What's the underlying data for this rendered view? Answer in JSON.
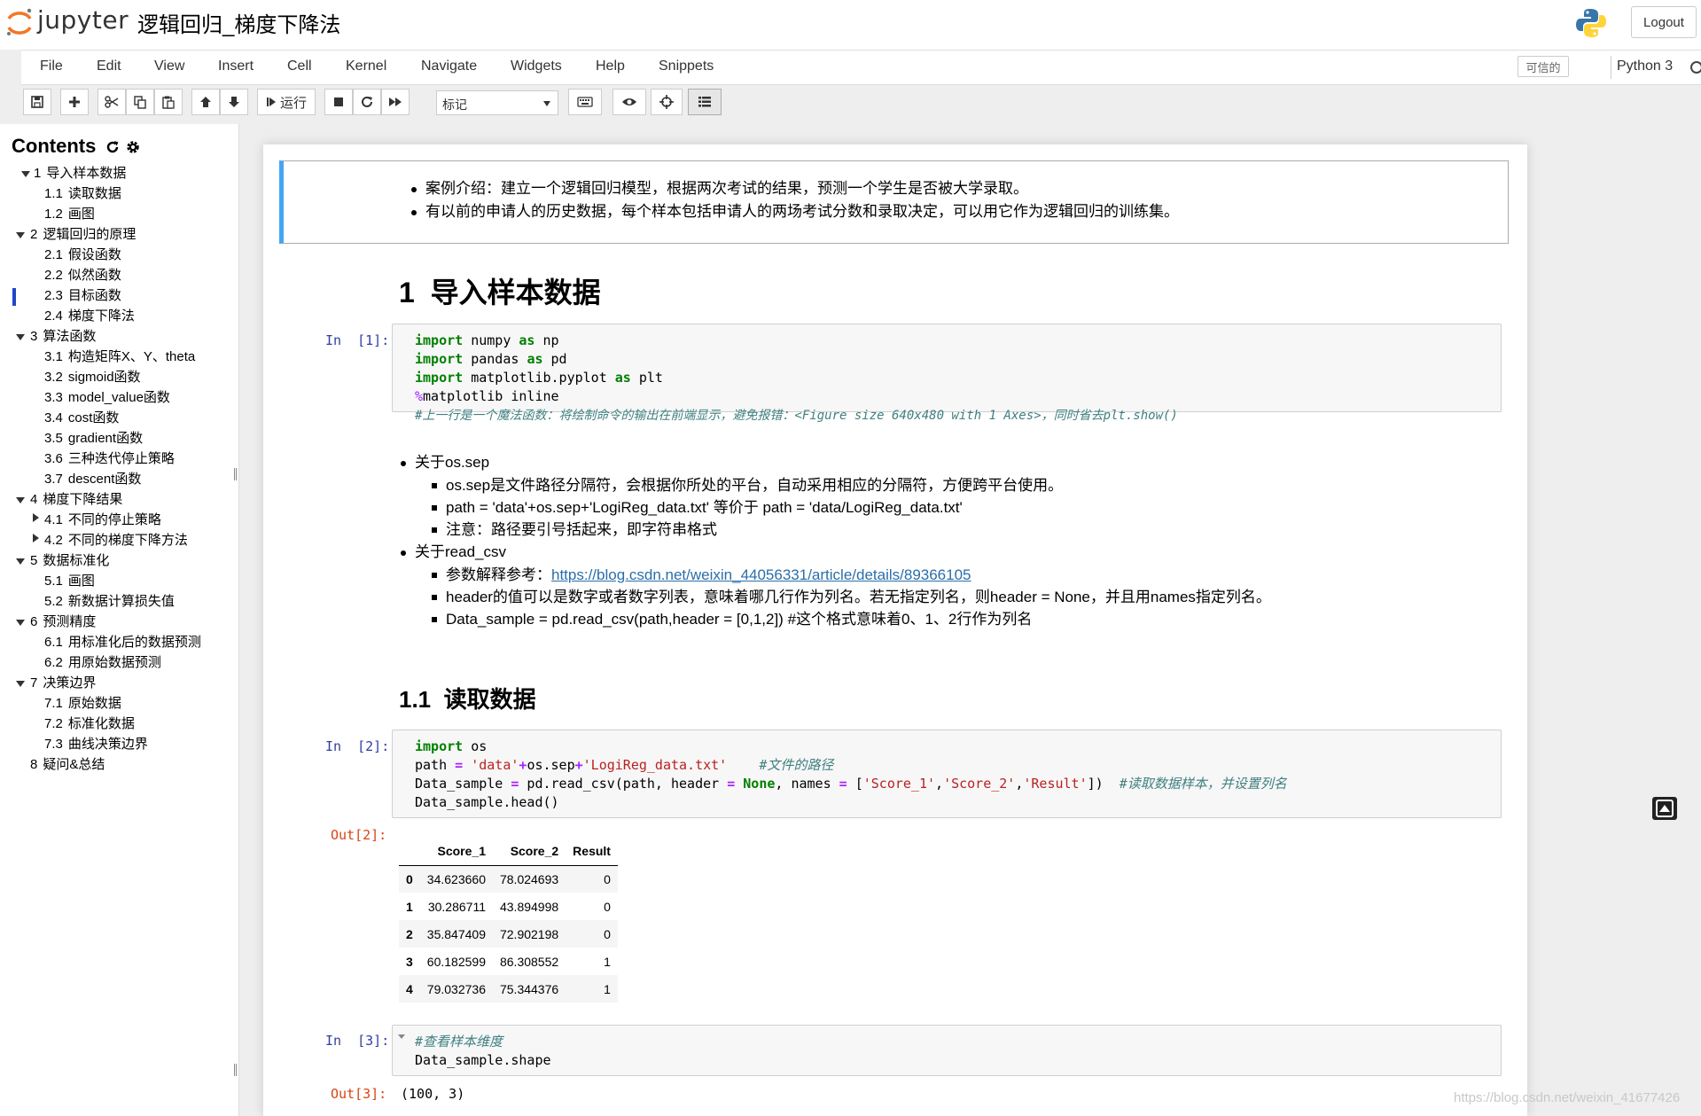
{
  "header": {
    "logo_text": "jupyter",
    "notebook_title": "逻辑回归_梯度下降法",
    "logout_label": "Logout"
  },
  "menubar": {
    "items": [
      "File",
      "Edit",
      "View",
      "Insert",
      "Cell",
      "Kernel",
      "Navigate",
      "Widgets",
      "Help",
      "Snippets"
    ],
    "trusted_label": "可信的",
    "kernel_name": "Python 3"
  },
  "toolbar": {
    "run_label": "运行",
    "cell_type": "标记",
    "icons": [
      "save-icon",
      "plus-icon",
      "cut-icon",
      "copy-icon",
      "paste-icon",
      "arrow-up-icon",
      "arrow-down-icon",
      "step-forward-icon",
      "stop-icon",
      "refresh-icon",
      "fast-forward-icon",
      "keyboard-icon",
      "eye-icon",
      "crosshairs-icon",
      "list-icon"
    ]
  },
  "toc": {
    "title": "Contents",
    "items": [
      {
        "num": "1",
        "label": "导入样本数据"
      },
      {
        "num": "1.1",
        "label": "读取数据"
      },
      {
        "num": "1.2",
        "label": "画图"
      },
      {
        "num": "2",
        "label": "逻辑回归的原理"
      },
      {
        "num": "2.1",
        "label": "假设函数"
      },
      {
        "num": "2.2",
        "label": "似然函数"
      },
      {
        "num": "2.3",
        "label": "目标函数"
      },
      {
        "num": "2.4",
        "label": "梯度下降法"
      },
      {
        "num": "3",
        "label": "算法函数"
      },
      {
        "num": "3.1",
        "label": "构造矩阵X、Y、theta"
      },
      {
        "num": "3.2",
        "label": "sigmoid函数"
      },
      {
        "num": "3.3",
        "label": "model_value函数"
      },
      {
        "num": "3.4",
        "label": "cost函数"
      },
      {
        "num": "3.5",
        "label": "gradient函数"
      },
      {
        "num": "3.6",
        "label": "三种迭代停止策略"
      },
      {
        "num": "3.7",
        "label": "descent函数"
      },
      {
        "num": "4",
        "label": "梯度下降结果"
      },
      {
        "num": "4.1",
        "label": "不同的停止策略"
      },
      {
        "num": "4.2",
        "label": "不同的梯度下降方法"
      },
      {
        "num": "5",
        "label": "数据标准化"
      },
      {
        "num": "5.1",
        "label": "画图"
      },
      {
        "num": "5.2",
        "label": "新数据计算损失值"
      },
      {
        "num": "6",
        "label": "预测精度"
      },
      {
        "num": "6.1",
        "label": "用标准化后的数据预测"
      },
      {
        "num": "6.2",
        "label": "用原始数据预测"
      },
      {
        "num": "7",
        "label": "决策边界"
      },
      {
        "num": "7.1",
        "label": "原始数据"
      },
      {
        "num": "7.2",
        "label": "标准化数据"
      },
      {
        "num": "7.3",
        "label": "曲线决策边界"
      },
      {
        "num": "8",
        "label": "疑问&总结"
      }
    ]
  },
  "cells": {
    "intro": [
      "案例介绍：建立一个逻辑回归模型，根据两次考试的结果，预测一个学生是否被大学录取。",
      "有以前的申请人的历史数据，每个样本包括申请人的两场考试分数和录取决定，可以用它作为逻辑回归的训练集。"
    ],
    "h1_num": "1",
    "h1_text": "导入样本数据",
    "cell1_prompt": "In  [1]:",
    "cell1_lines": {
      "l1_kw": "import",
      "l1_mod": " numpy ",
      "l1_as": "as",
      "l1_alias": " np",
      "l2_kw": "import",
      "l2_mod": " pandas ",
      "l2_as": "as",
      "l2_alias": " pd",
      "l3_kw": "import",
      "l3_mod": " matplotlib.pyplot ",
      "l3_as": "as",
      "l3_alias": " plt",
      "l4_pct": "%",
      "l4_rest": "matplotlib inline",
      "l5_comment": "#上一行是一个魔法函数：将绘制命令的输出在前端显示，避免报错：<Figure size 640x480 with 1 Axes>，同时省去plt.show()"
    },
    "ossep": {
      "title": "关于os.sep",
      "sub": [
        "os.sep是文件路径分隔符，会根据你所处的平台，自动采用相应的分隔符，方便跨平台使用。",
        "path = 'data'+os.sep+'LogiReg_data.txt' 等价于 path = 'data/LogiReg_data.txt'",
        "注意：路径要引号括起来，即字符串格式"
      ],
      "readcsv_title": "关于read_csv",
      "ref_prefix": "参数解释参考：",
      "ref_link": "https://blog.csdn.net/weixin_44056331/article/details/89366105",
      "readcsv_sub": [
        "header的值可以是数字或者数字列表，意味着哪几行作为列名。若无指定列名，则header = None，并且用names指定列名。",
        "Data_sample = pd.read_csv(path,header = [0,1,2]) #这个格式意味着0、1、2行作为列名"
      ]
    },
    "h2_num": "1.1",
    "h2_text": "读取数据",
    "cell2_prompt": "In  [2]:",
    "cell2_lines": {
      "l1_kw": "import",
      "l1_rest": " os",
      "l2_a": "path ",
      "l2_eq": "=",
      "l2_s1": " 'data'",
      "l2_plus": "+",
      "l2_b": "os.sep",
      "l2_plus2": "+",
      "l2_s2": "'LogiReg_data.txt'",
      "l2_sp": "    ",
      "l2_cm": "#文件的路径",
      "l3_a": "Data_sample ",
      "l3_eq": "=",
      "l3_b": " pd.read_csv(path, header ",
      "l3_eq2": "=",
      "l3_none": " None",
      "l3_c": ", names ",
      "l3_eq3": "=",
      "l3_d": " [",
      "l3_s1": "'Score_1'",
      "l3_e": ",",
      "l3_s2": "'Score_2'",
      "l3_f": ",",
      "l3_s3": "'Result'",
      "l3_g": "])  ",
      "l3_cm": "#读取数据样本，并设置列名",
      "l4": "Data_sample.head()"
    },
    "out2_prompt": "Out[2]:",
    "table": {
      "columns": [
        "Score_1",
        "Score_2",
        "Result"
      ],
      "rows": [
        {
          "idx": "0",
          "s1": "34.623660",
          "s2": "78.024693",
          "r": "0"
        },
        {
          "idx": "1",
          "s1": "30.286711",
          "s2": "43.894998",
          "r": "0"
        },
        {
          "idx": "2",
          "s1": "35.847409",
          "s2": "72.902198",
          "r": "0"
        },
        {
          "idx": "3",
          "s1": "60.182599",
          "s2": "86.308552",
          "r": "1"
        },
        {
          "idx": "4",
          "s1": "79.032736",
          "s2": "75.344376",
          "r": "1"
        }
      ]
    },
    "cell3_prompt": "In  [3]:",
    "cell3_lines": {
      "l1_cm": "#查看样本维度",
      "l2": "Data_sample.shape"
    },
    "out3_prompt": "Out[3]:",
    "out3_text": "(100, 3)"
  },
  "watermark": "https://blog.csdn.net/weixin_41677426",
  "colors": {
    "accent_blue": "#42a5f5",
    "prompt_in": "#303f9f",
    "prompt_out": "#d84315",
    "toc_active": "#1e48c8"
  }
}
